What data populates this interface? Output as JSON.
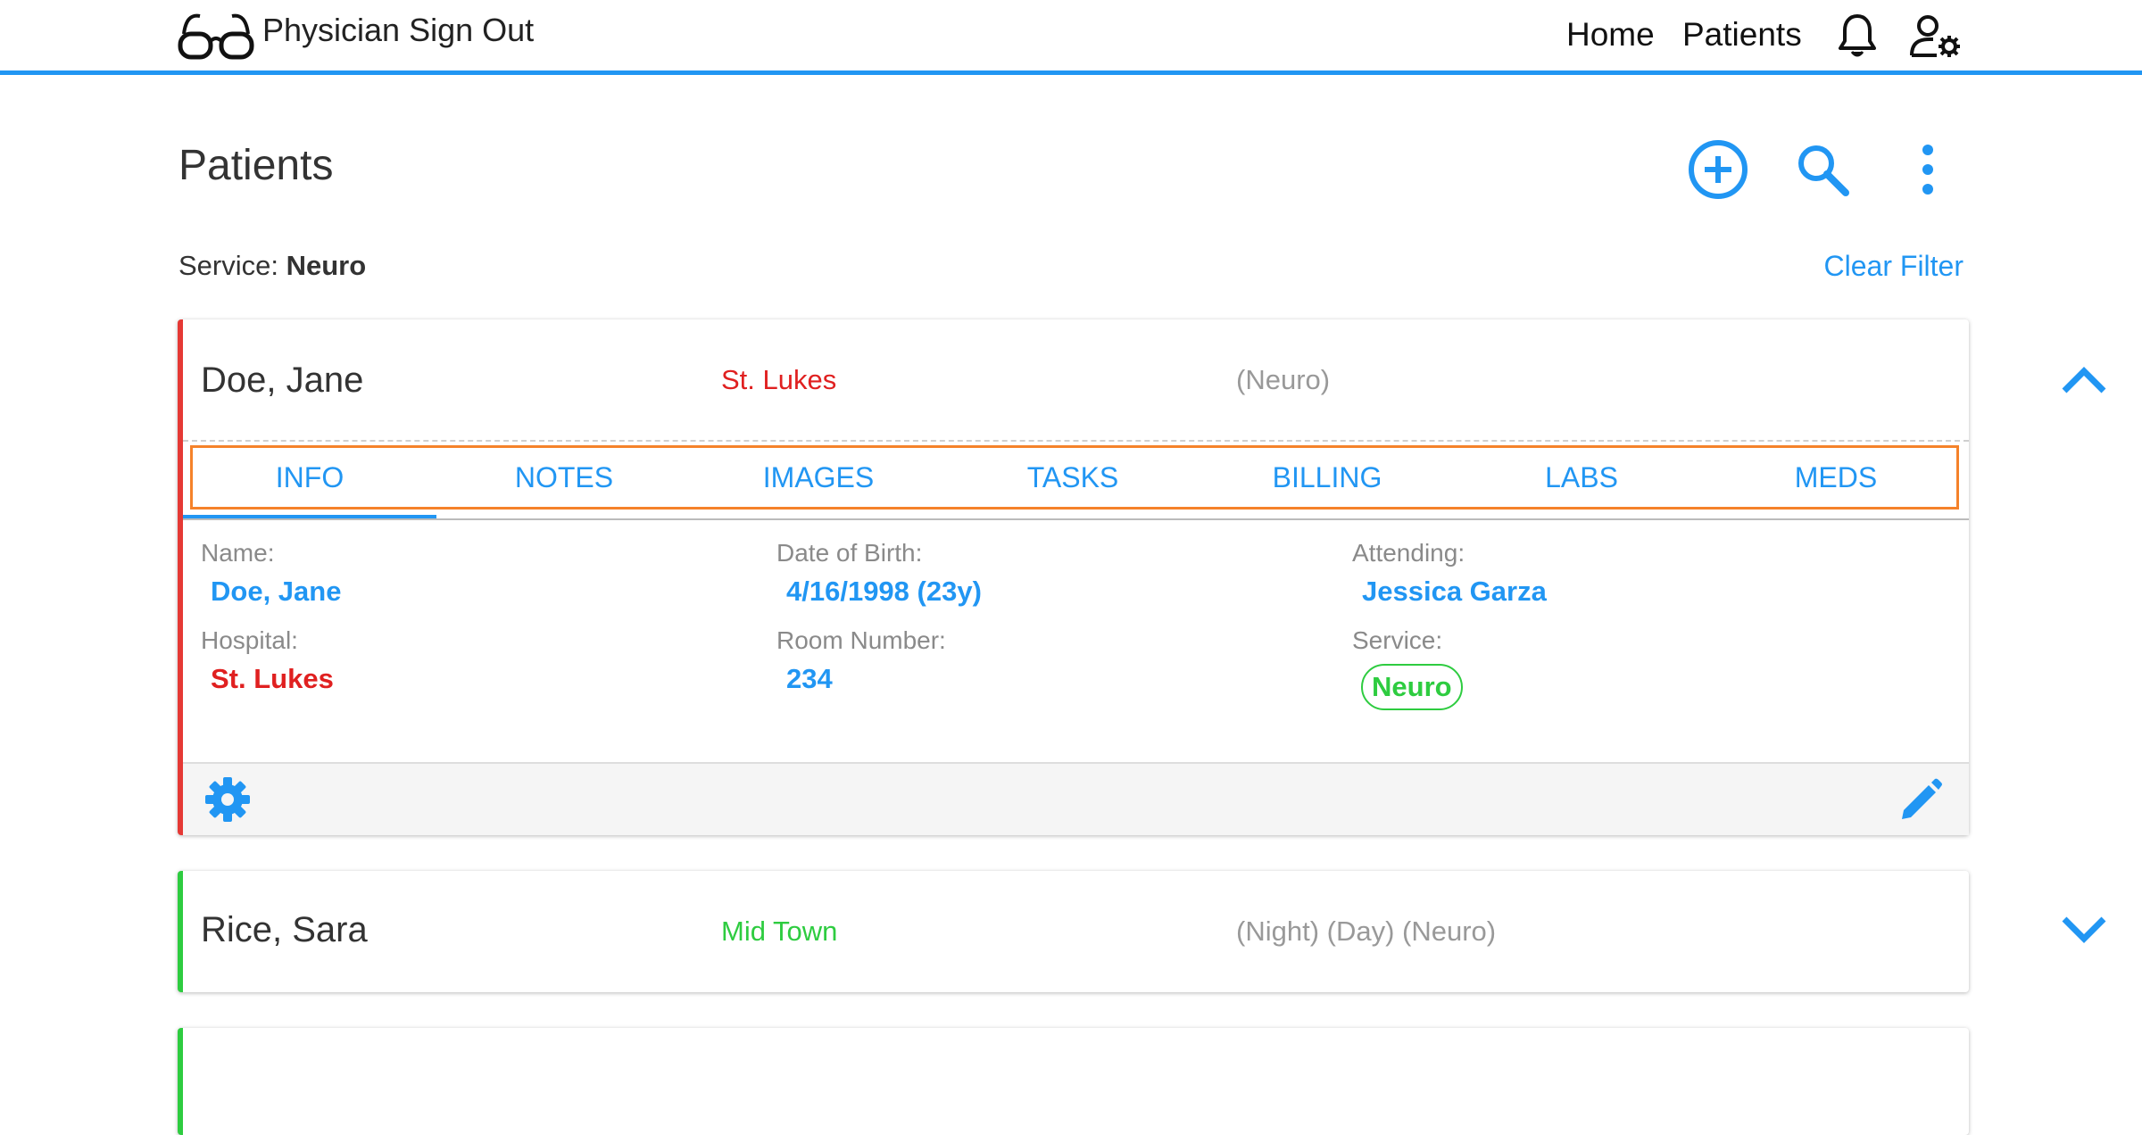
{
  "header": {
    "app_title": "Physician Sign Out",
    "nav": [
      {
        "label": "Home"
      },
      {
        "label": "Patients"
      }
    ]
  },
  "page": {
    "title": "Patients",
    "filter_label": "Service:",
    "filter_value": "Neuro",
    "clear_filter": "Clear Filter"
  },
  "patients": [
    {
      "name": "Doe, Jane",
      "hospital": "St. Lukes",
      "services": "(Neuro)",
      "expanded": true,
      "tabs": [
        "INFO",
        "NOTES",
        "IMAGES",
        "TASKS",
        "BILLING",
        "LABS",
        "MEDS"
      ],
      "active_tab": "INFO",
      "info": {
        "name_label": "Name:",
        "name": "Doe, Jane",
        "dob_label": "Date of Birth:",
        "dob": "4/16/1998 (23y)",
        "attending_label": "Attending:",
        "attending": "Jessica Garza",
        "hospital_label": "Hospital:",
        "hospital": "St. Lukes",
        "room_label": "Room Number:",
        "room": "234",
        "service_label": "Service:",
        "service": "Neuro"
      }
    },
    {
      "name": "Rice, Sara",
      "hospital": "Mid Town",
      "services": "(Night) (Day) (Neuro)",
      "expanded": false
    }
  ],
  "colors": {
    "accent": "#2196f3",
    "hospital_st_lukes": "#e02020",
    "hospital_mid_town": "#2ecc40",
    "tab_highlight": "#f5822a"
  }
}
